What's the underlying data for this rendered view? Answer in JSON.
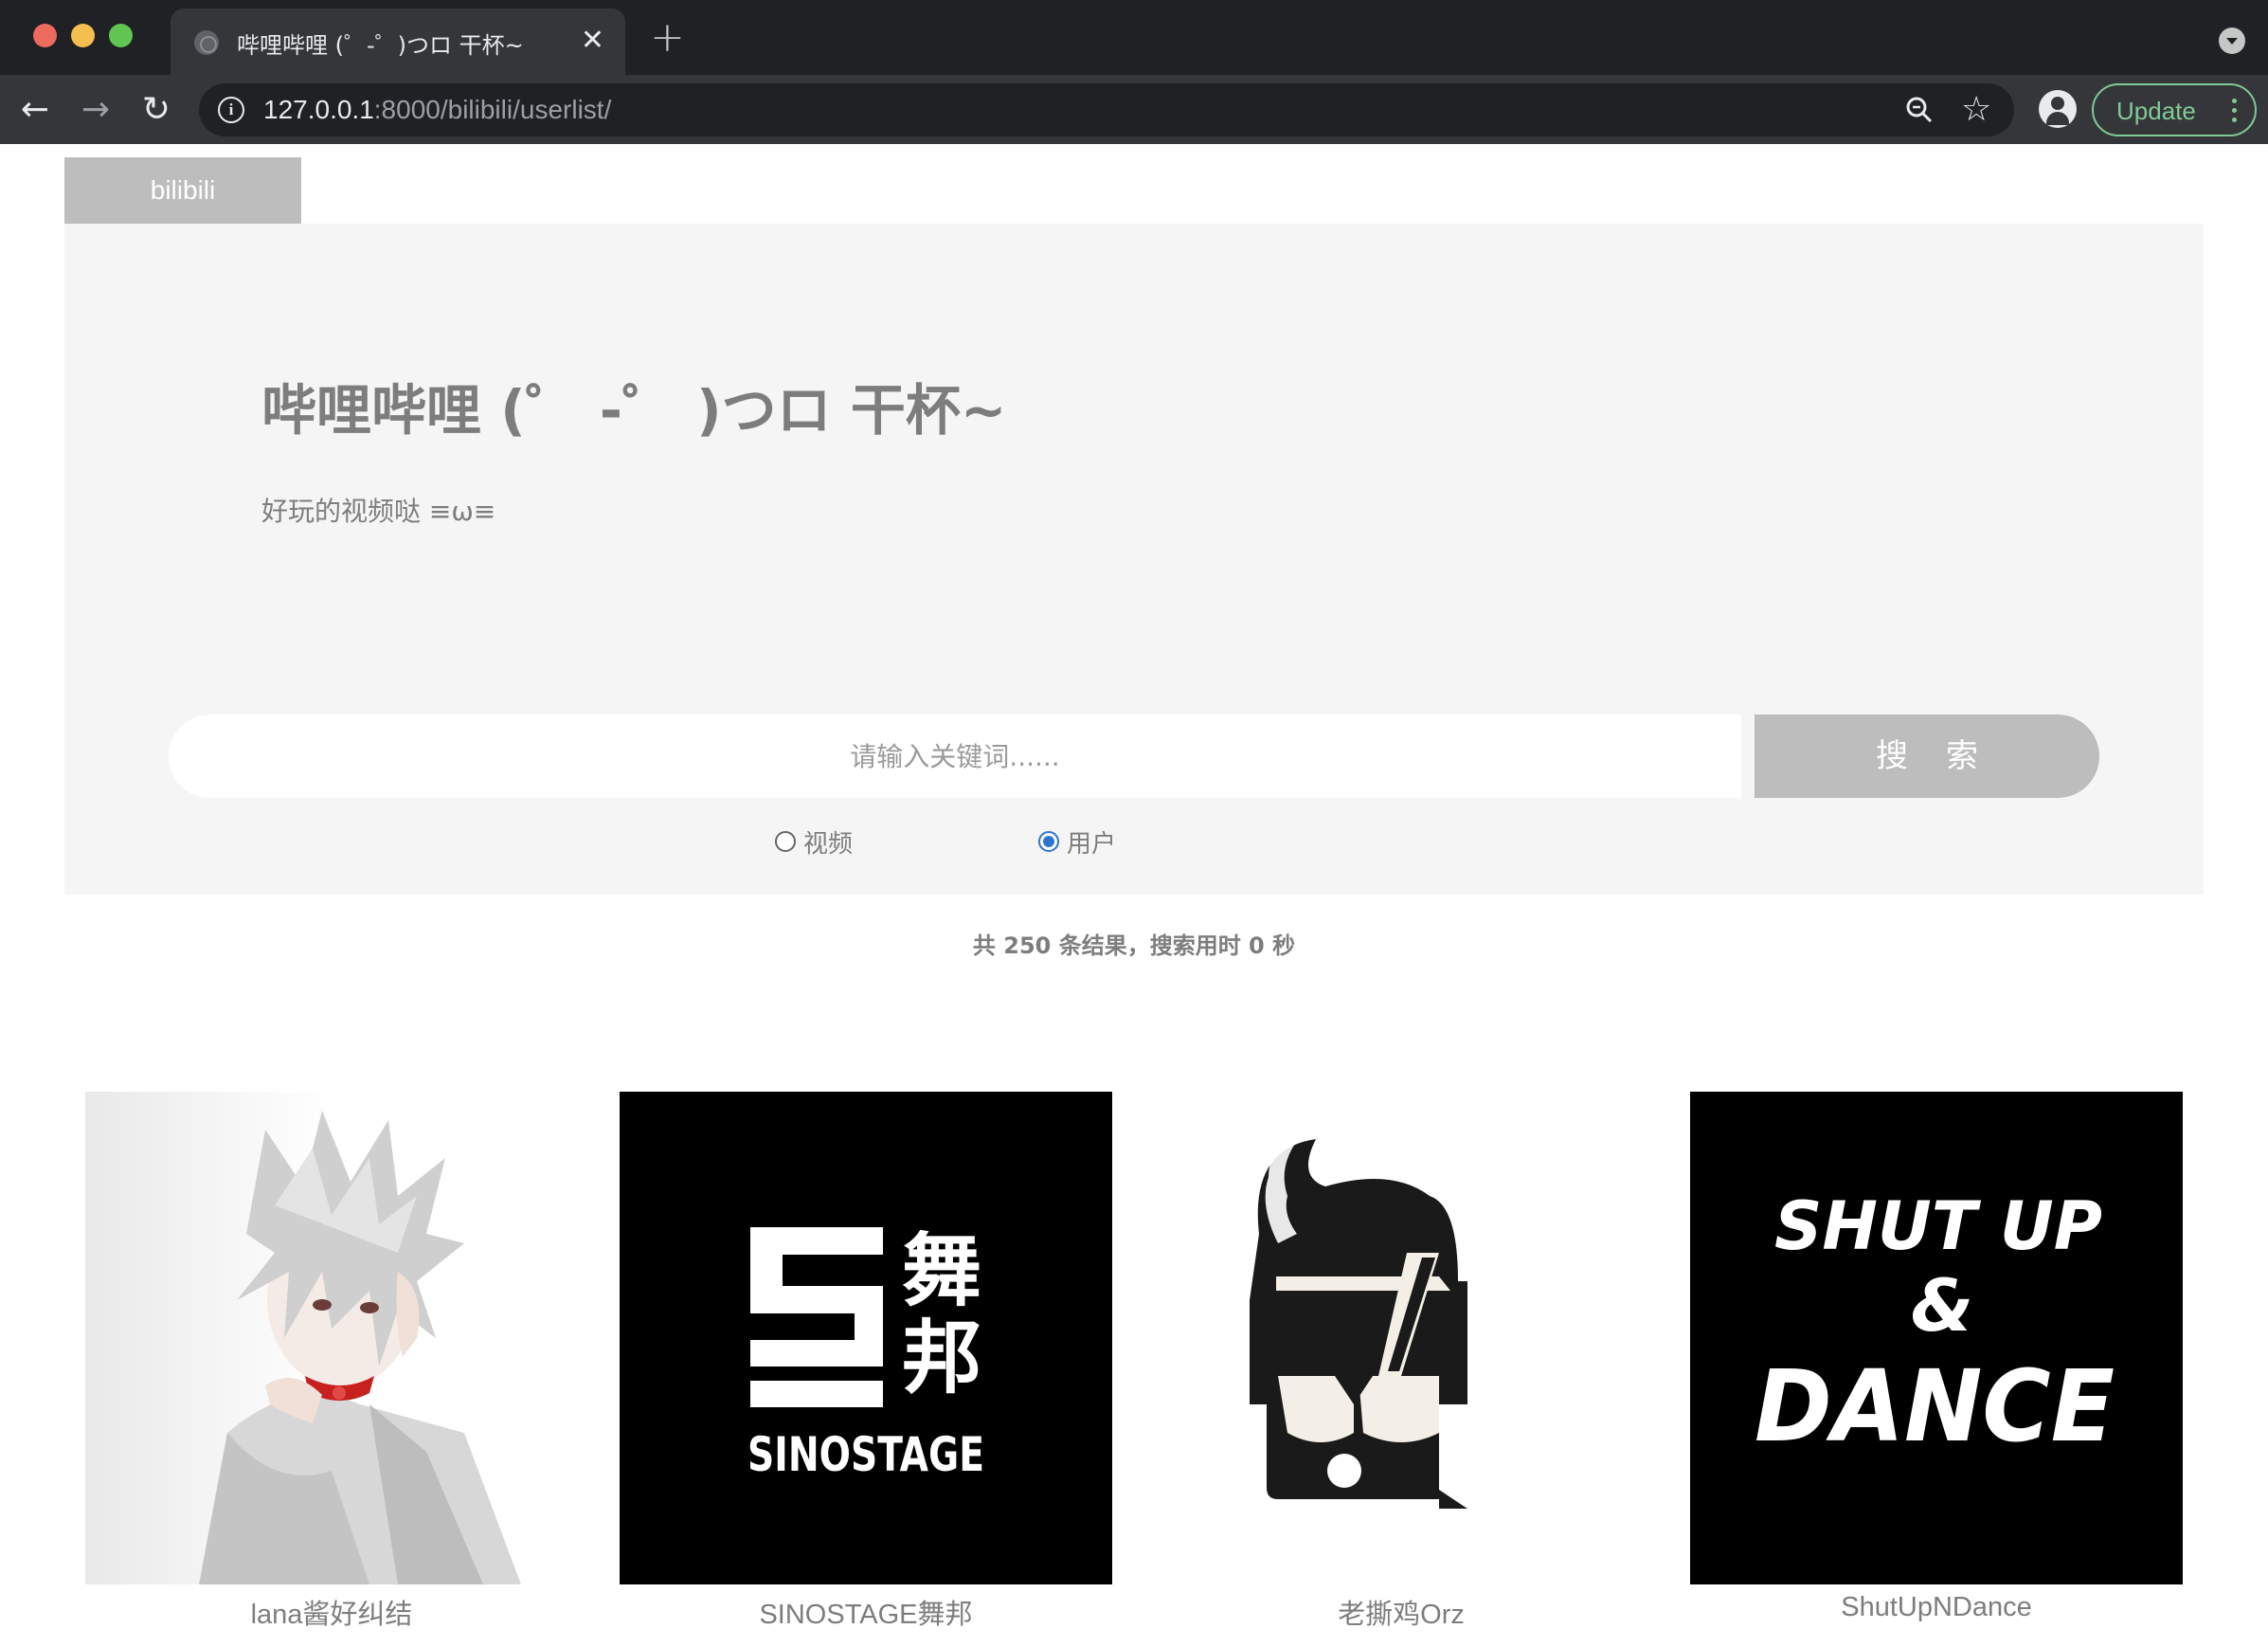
{
  "browser": {
    "tab_title": "哔哩哔哩 (゜-゜)つロ 干杯~",
    "url_host": "127.0.0.1",
    "url_rest": ":8000/bilibili/userlist/",
    "update_label": "Update"
  },
  "site": {
    "brand": "bilibili",
    "hero_title": "哔哩哔哩 (゜ -゜ )つロ 干杯~",
    "hero_subtitle": "好玩的视频哒 ≡ω≡"
  },
  "search": {
    "placeholder": "请输入关键词......",
    "button_label": "搜索",
    "options": [
      {
        "label": "视频",
        "checked": false
      },
      {
        "label": "用户",
        "checked": true
      }
    ],
    "result_info": "共 250 条结果，搜索用时 0 秒"
  },
  "users": [
    {
      "name": "lana酱好纠结",
      "avatar": "anime-character-avatar"
    },
    {
      "name": "SINOSTAGE舞邦",
      "avatar": "sinostage-logo",
      "logo_text": [
        "舞",
        "邦",
        "SINOSTAGE"
      ]
    },
    {
      "name": "老撕鸡Orz",
      "avatar": "sunglasses-character-logo"
    },
    {
      "name": "ShutUpNDance",
      "avatar": "shut-up-and-dance-logo",
      "logo_text": [
        "SHUT UP",
        "&",
        "DANCE"
      ]
    }
  ],
  "colors": {
    "chrome_dark": "#202124",
    "chrome_toolbar": "#35363a",
    "update_green": "#81c995",
    "hero_bg": "#f5f5f5",
    "accent_grey": "#bdbdbd",
    "text_grey": "#7d7d7d",
    "radio_blue": "#2f74d0"
  }
}
